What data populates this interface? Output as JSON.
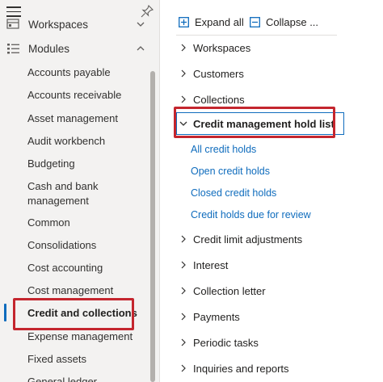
{
  "nav": {
    "sections": {
      "workspaces": "Workspaces",
      "modules": "Modules"
    },
    "modules": [
      "Accounts payable",
      "Accounts receivable",
      "Asset management",
      "Audit workbench",
      "Budgeting",
      "Cash and bank management",
      "Common",
      "Consolidations",
      "Cost accounting",
      "Cost management",
      "Credit and collections",
      "Expense management",
      "Fixed assets",
      "General ledger"
    ],
    "selected_module": "Credit and collections"
  },
  "toolbar": {
    "expand_all": "Expand all",
    "collapse": "Collapse ..."
  },
  "tree": {
    "workspaces": "Workspaces",
    "customers": "Customers",
    "collections": "Collections",
    "credit_hold_list": "Credit management hold list",
    "credit_hold_links": [
      "All credit holds",
      "Open credit holds",
      "Closed credit holds",
      "Credit holds due for review"
    ],
    "credit_limit_adjustments": "Credit limit adjustments",
    "interest": "Interest",
    "collection_letter": "Collection letter",
    "payments": "Payments",
    "periodic_tasks": "Periodic tasks",
    "inquiries_and_reports": "Inquiries and reports"
  },
  "colors": {
    "accent": "#0f6cbd",
    "highlight_box": "#c4262e",
    "nav_background": "#f3f2f1"
  }
}
